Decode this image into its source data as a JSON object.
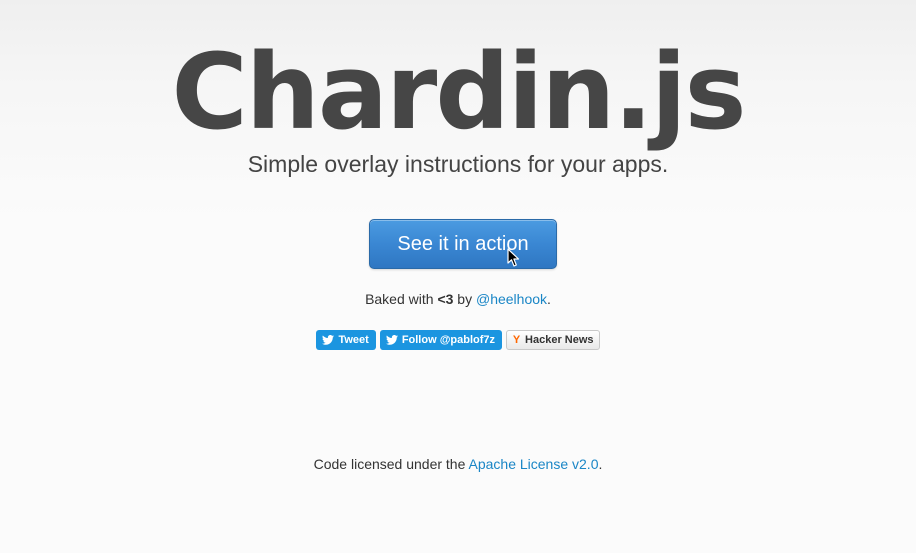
{
  "header": {
    "title": "Chardin.js",
    "subtitle": "Simple overlay instructions for your apps."
  },
  "cta": {
    "label": "See it in action",
    "color": "#3a87d3"
  },
  "baked": {
    "prefix": "Baked with ",
    "heart": "<3",
    "by": " by ",
    "author": "@heelhook",
    "suffix": "."
  },
  "social": {
    "tweet_label": "Tweet",
    "follow_label": "Follow @pablof7z",
    "hn_label": "Hacker News",
    "hn_logo": "Y",
    "twitter_color": "#1b95e0",
    "hn_color": "#ff6600"
  },
  "footer": {
    "prefix": "Code licensed under the ",
    "license_link": "Apache License v2.0",
    "suffix": "."
  },
  "colors": {
    "link": "#1a86c6",
    "title": "#464646"
  }
}
